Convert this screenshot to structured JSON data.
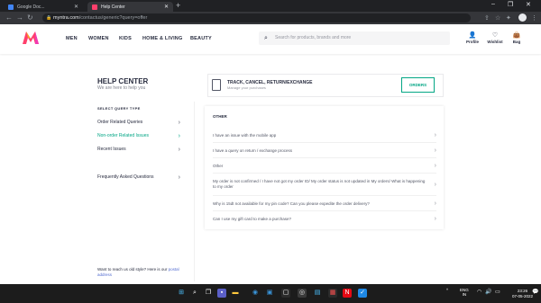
{
  "browser": {
    "tabs": [
      {
        "title": "Google Doc..."
      },
      {
        "title": "Help Center"
      }
    ],
    "url_host": "myntra.com",
    "url_path": "/contactus/generic?query=offer"
  },
  "header": {
    "menu": [
      "MEN",
      "WOMEN",
      "KIDS",
      "HOME & LIVING",
      "BEAUTY"
    ],
    "search_placeholder": "Search for products, brands and more",
    "actions": [
      "Profile",
      "Wishlist",
      "Bag"
    ]
  },
  "help": {
    "title": "HELP CENTER",
    "subtitle": "We are here to help you"
  },
  "track": {
    "title": "TRACK, CANCEL, RETURN/EXCHANGE",
    "subtitle": "Manage your purchases",
    "button": "ORDERS"
  },
  "sidebar": {
    "heading": "SELECT QUERY TYPE",
    "items": [
      "Order Related Queries",
      "Non-order Related Issues",
      "Recent Issues"
    ],
    "faq": "Frequently Asked Questions"
  },
  "panel": {
    "heading": "OTHER",
    "questions": [
      "I have an issue with the mobile app",
      "I have a query on return / exchange process",
      "Other",
      "My order is not confirmed / I have not got my order ID/ My order status is not updated in My orders/ What is happening to my order",
      "Why is 15dt not available for my pin code? Can you please expedite the order delivery?",
      "Can I use my gift card to make a purchase?"
    ]
  },
  "oldstyle": {
    "text": "Want to reach us old style? Here is our",
    "link": "postal address"
  },
  "taskbar": {
    "lang": "ENG",
    "region": "IN",
    "time": "23:26",
    "date": "07-05-2022"
  },
  "colors": {
    "brand_green": "#03a685",
    "myntra_pink": "#ff3f6c",
    "myntra_orange": "#f5a623"
  }
}
